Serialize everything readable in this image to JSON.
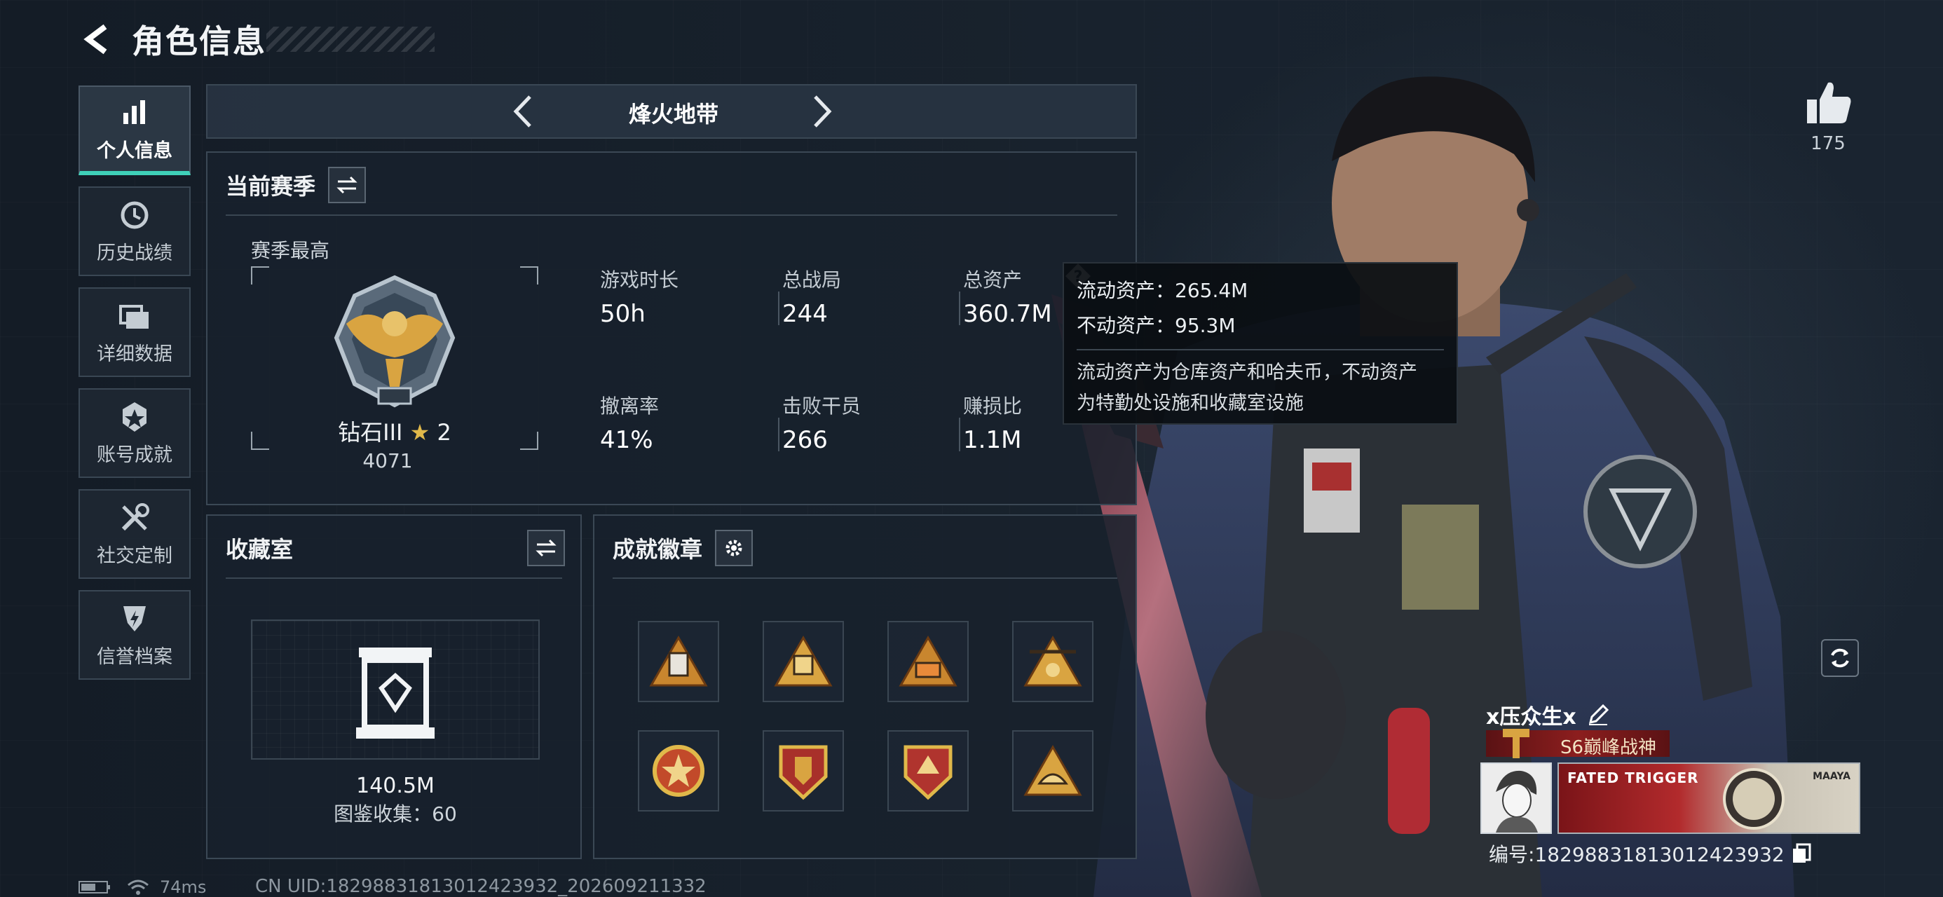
{
  "header": {
    "title": "角色信息"
  },
  "sidebar": {
    "items": [
      {
        "label": "个人信息",
        "icon": "bar-chart-icon",
        "active": true
      },
      {
        "label": "历史战绩",
        "icon": "clock-icon",
        "active": false
      },
      {
        "label": "详细数据",
        "icon": "folders-icon",
        "active": false
      },
      {
        "label": "账号成就",
        "icon": "medal-icon",
        "active": false
      },
      {
        "label": "社交定制",
        "icon": "tools-icon",
        "active": false
      },
      {
        "label": "信誉档案",
        "icon": "shield-bolt-icon",
        "active": false
      }
    ]
  },
  "mode": {
    "title": "烽火地带"
  },
  "season": {
    "title": "当前赛季",
    "best_label": "赛季最高",
    "rank_name": "钻石III",
    "rank_star": "★",
    "rank_stars": "2",
    "rank_score": "4071",
    "stats": [
      {
        "label": "游戏时长",
        "value": "50h"
      },
      {
        "label": "总战局",
        "value": "244"
      },
      {
        "label": "总资产",
        "value": "360.7M"
      },
      {
        "label": "撤离率",
        "value": "41%"
      },
      {
        "label": "击败干员",
        "value": "266"
      },
      {
        "label": "赚损比",
        "value": "1.1M"
      }
    ]
  },
  "tooltip": {
    "liquid": "流动资产：265.4M",
    "fixed": "不动资产：95.3M",
    "desc_1": "流动资产为仓库资产和哈夫币，不动资产",
    "desc_2": "为特勤处设施和收藏室设施"
  },
  "collection": {
    "title": "收藏室",
    "value": "140.5M",
    "count_text": "图鉴收集：60"
  },
  "badges": {
    "title": "成就徽章",
    "items": [
      "badge-1",
      "badge-2",
      "badge-3",
      "badge-4",
      "badge-5",
      "badge-6",
      "badge-7",
      "badge-8"
    ]
  },
  "likes": {
    "count": "175"
  },
  "player": {
    "name": "x压众生x",
    "title": "S6巅峰战神",
    "card_text": "FATED TRIGGER",
    "card_logo": "MAAYA",
    "id_text": "编号:1829883181301242393​2"
  },
  "status": {
    "ping": "74ms"
  },
  "uid_text": "CN UID:1829883181301242393​2_202609211332",
  "colors": {
    "accent": "#3fd0b8",
    "gold": "#e0b84a",
    "banner": "#8c1e1e"
  }
}
